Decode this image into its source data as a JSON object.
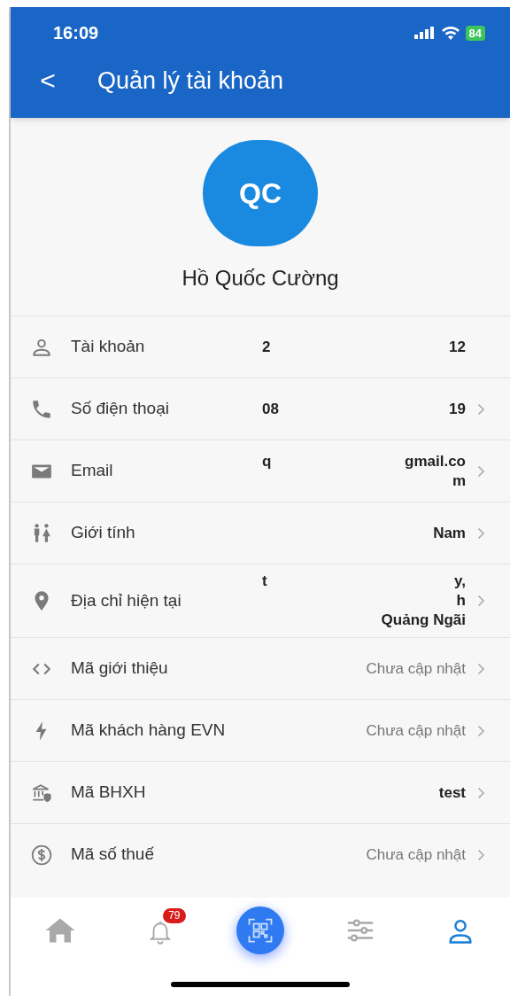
{
  "status_bar": {
    "time": "16:09",
    "battery": "84"
  },
  "header": {
    "back": "<",
    "title": "Quản lý tài khoản"
  },
  "profile": {
    "initials": "QC",
    "name": "Hồ Quốc Cường"
  },
  "rows": [
    {
      "kind": "user",
      "label": "Tài khoản",
      "value_lines": [
        [
          "2",
          "12"
        ]
      ],
      "muted": false,
      "chevron": false
    },
    {
      "kind": "phone",
      "label": "Số điện thoại",
      "value_lines": [
        [
          "08",
          "19"
        ]
      ],
      "muted": false,
      "chevron": true
    },
    {
      "kind": "mail",
      "label": "Email",
      "value_lines": [
        [
          "q",
          "gmail.co"
        ],
        [
          "m"
        ]
      ],
      "muted": false,
      "chevron": true
    },
    {
      "kind": "gender",
      "label": "Giới tính",
      "value_lines": [
        [
          "Nam"
        ]
      ],
      "muted": false,
      "chevron": true
    },
    {
      "kind": "pin",
      "label": "Địa chỉ hiện tại",
      "value_lines": [
        [
          "t",
          "y,"
        ],
        [
          "h"
        ],
        [
          "Quảng Ngãi"
        ]
      ],
      "muted": false,
      "chevron": true
    },
    {
      "kind": "code",
      "label": "Mã giới thiệu",
      "value_lines": [
        [
          "Chưa cập nhật"
        ]
      ],
      "muted": true,
      "chevron": true
    },
    {
      "kind": "bolt",
      "label": "Mã khách hàng EVN",
      "value_lines": [
        [
          "Chưa cập nhật"
        ]
      ],
      "muted": true,
      "chevron": true
    },
    {
      "kind": "bank",
      "label": "Mã BHXH",
      "value_lines": [
        [
          "test"
        ]
      ],
      "muted": false,
      "chevron": true
    },
    {
      "kind": "dollar",
      "label": "Mã số thuế",
      "value_lines": [
        [
          "Chưa cập nhật"
        ]
      ],
      "muted": true,
      "chevron": true
    }
  ],
  "nav": [
    {
      "kind": "home",
      "selected": false
    },
    {
      "kind": "bell",
      "selected": false,
      "badge": "79"
    },
    {
      "kind": "qr",
      "selected": false
    },
    {
      "kind": "sliders",
      "selected": false
    },
    {
      "kind": "user",
      "selected": true
    }
  ]
}
